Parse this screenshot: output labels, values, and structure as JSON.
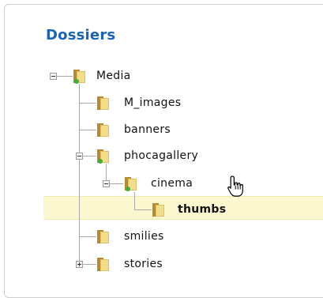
{
  "panel": {
    "title": "Dossiers"
  },
  "tree": {
    "root": {
      "label": "Media",
      "expanded": true
    },
    "items": [
      {
        "label": "M_images"
      },
      {
        "label": "banners"
      },
      {
        "label": "phocagallery",
        "expanded": true,
        "children": [
          {
            "label": "cinema",
            "expanded": true,
            "children": [
              {
                "label": "thumbs",
                "selected": true
              }
            ]
          }
        ]
      },
      {
        "label": "smilies"
      },
      {
        "label": "stories",
        "expanded": false
      }
    ]
  },
  "icons": {
    "folder": "folder-icon",
    "folder_open": "folder-open-icon",
    "cursor": "hand-pointer-icon"
  },
  "colors": {
    "title": "#1a63b5",
    "selection_bg": "#fbf7cf",
    "folder": "#c9a84a"
  }
}
